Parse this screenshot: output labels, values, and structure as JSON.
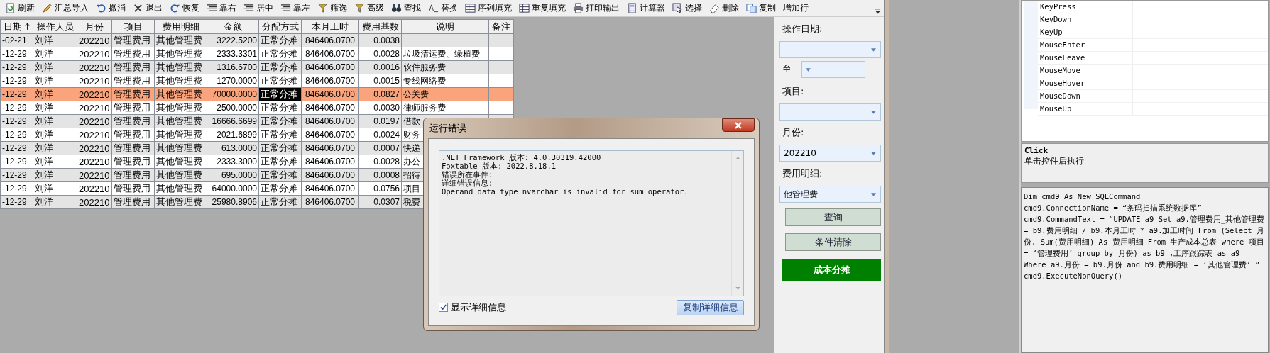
{
  "toolbar": {
    "items": [
      {
        "label": "刷新"
      },
      {
        "label": "汇总导入"
      },
      {
        "label": "撤消"
      },
      {
        "label": "退出"
      },
      {
        "label": "恢复"
      },
      {
        "label": "靠右"
      },
      {
        "label": "居中"
      },
      {
        "label": "靠左"
      },
      {
        "label": "筛选"
      },
      {
        "label": "高级"
      },
      {
        "label": "查找"
      },
      {
        "label": "替换"
      },
      {
        "label": "序列填充"
      },
      {
        "label": "重复填充"
      },
      {
        "label": "打印输出"
      },
      {
        "label": "计算器"
      },
      {
        "label": "选择"
      },
      {
        "label": "删除"
      },
      {
        "label": "复制"
      },
      {
        "label": "增加行"
      }
    ]
  },
  "table": {
    "columns": [
      {
        "label": "日期",
        "sorted_ascending": true,
        "current": false
      },
      {
        "label": "操作人员",
        "current": false
      },
      {
        "label": "月份",
        "current": false
      },
      {
        "label": "项目",
        "current": false
      },
      {
        "label": "费用明细",
        "current": false
      },
      {
        "label": "金额",
        "current": false
      },
      {
        "label": "分配方式",
        "current": true
      },
      {
        "label": "本月工时",
        "current": false
      },
      {
        "label": "费用基数",
        "current": false
      },
      {
        "label": "说明",
        "current": false
      },
      {
        "label": "备注",
        "current": false
      }
    ],
    "rows": [
      {
        "selected": false,
        "cells": [
          "-02-21",
          "刘洋",
          "202210",
          "管理费用",
          "其他管理费",
          "3222.5200",
          "正常分摊",
          "846406.0700",
          "0.0038"
        ]
      },
      {
        "selected": false,
        "cells": [
          "-12-29",
          "刘洋",
          "202210",
          "管理费用",
          "其他管理费",
          "2333.3301",
          "正常分摊",
          "846406.0700",
          "0.0028",
          "垃圾清运费、绿植费"
        ]
      },
      {
        "selected": false,
        "cells": [
          "-12-29",
          "刘洋",
          "202210",
          "管理费用",
          "其他管理费",
          "1316.6700",
          "正常分摊",
          "846406.0700",
          "0.0016",
          "软件服务费"
        ]
      },
      {
        "selected": false,
        "cells": [
          "-12-29",
          "刘洋",
          "202210",
          "管理费用",
          "其他管理费",
          "1270.0000",
          "正常分摊",
          "846406.0700",
          "0.0015",
          "专线网络费"
        ]
      },
      {
        "selected": true,
        "cells": [
          "-12-29",
          "刘洋",
          "202210",
          "管理费用",
          "其他管理费",
          "70000.0000",
          "正常分摊",
          "846406.0700",
          "0.0827",
          "公关费"
        ]
      },
      {
        "selected": false,
        "cells": [
          "-12-29",
          "刘洋",
          "202210",
          "管理费用",
          "其他管理费",
          "2500.0000",
          "正常分摊",
          "846406.0700",
          "0.0030",
          "律师服务费"
        ]
      },
      {
        "selected": false,
        "cells": [
          "-12-29",
          "刘洋",
          "202210",
          "管理费用",
          "其他管理费",
          "16666.6699",
          "正常分摊",
          "846406.0700",
          "0.0197",
          "借款"
        ]
      },
      {
        "selected": false,
        "cells": [
          "-12-29",
          "刘洋",
          "202210",
          "管理费用",
          "其他管理费",
          "2021.6899",
          "正常分摊",
          "846406.0700",
          "0.0024",
          "财务"
        ]
      },
      {
        "selected": false,
        "cells": [
          "-12-29",
          "刘洋",
          "202210",
          "管理费用",
          "其他管理费",
          "613.0000",
          "正常分摊",
          "846406.0700",
          "0.0007",
          "快递"
        ]
      },
      {
        "selected": false,
        "cells": [
          "-12-29",
          "刘洋",
          "202210",
          "管理费用",
          "其他管理费",
          "2333.3000",
          "正常分摊",
          "846406.0700",
          "0.0028",
          "办公"
        ]
      },
      {
        "selected": false,
        "cells": [
          "-12-29",
          "刘洋",
          "202210",
          "管理费用",
          "其他管理费",
          "695.0000",
          "正常分摊",
          "846406.0700",
          "0.0008",
          "招待"
        ]
      },
      {
        "selected": false,
        "cells": [
          "-12-29",
          "刘洋",
          "202210",
          "管理费用",
          "其他管理费",
          "64000.0000",
          "正常分摊",
          "846406.0700",
          "0.0756",
          "项目"
        ]
      },
      {
        "selected": false,
        "cells": [
          "-12-29",
          "刘洋",
          "202210",
          "管理费用",
          "其他管理费",
          "25980.8906",
          "正常分摊",
          "846406.0700",
          "0.0307",
          "税费"
        ]
      }
    ]
  },
  "filter_panel": {
    "items": [
      {
        "kind": "label",
        "text": "操作日期:"
      },
      {
        "kind": "combo"
      },
      {
        "kind": "range",
        "text": "至"
      },
      {
        "kind": "label",
        "text": "项目:"
      },
      {
        "kind": "combo"
      },
      {
        "kind": "label",
        "text": "月份:"
      },
      {
        "kind": "combo",
        "value": "202210"
      },
      {
        "kind": "label",
        "text": "费用明细:"
      },
      {
        "kind": "combo",
        "value": "他管理费"
      },
      {
        "kind": "button",
        "text": "查询"
      },
      {
        "kind": "button",
        "text": "条件清除"
      },
      {
        "kind": "primary",
        "text": "成本分摊"
      }
    ]
  },
  "dialog": {
    "title": "运行错误",
    "details": [
      ".NET Framework 版本: 4.0.30319.42000",
      "Foxtable 版本: 2022.8.18.1",
      "错误所在事件:",
      "详细错误信息:",
      "Operand data type nvarchar is invalid for sum operator."
    ],
    "show_details": {
      "label": "显示详细信息",
      "checked": true
    },
    "copy_button": "复制详细信息"
  },
  "event_list": {
    "items": [
      {
        "name": "KeyPress"
      },
      {
        "name": "KeyDown"
      },
      {
        "name": "KeyUp"
      },
      {
        "name": "MouseEnter"
      },
      {
        "name": "MouseLeave"
      },
      {
        "name": "MouseMove"
      },
      {
        "name": "MouseHover"
      },
      {
        "name": "MouseDown"
      },
      {
        "name": "MouseUp"
      }
    ]
  },
  "event_help": {
    "title": "Click",
    "text": "单击控件后执行"
  },
  "code": {
    "lines": [
      "Dim cmd9 As New SQLCommand",
      "cmd9.ConnectionName = “条码扫描系统数据库”",
      "cmd9.CommandText = “UPDATE  a9 Set a9.管理费用_其他管理费 = b9.费用明细 / b9.本月工时 * a9.加工时间   From (Select 月份, Sum(费用明细) As 费用明细  From 生产成本总表 where 项目 = ‘管理费用’ group by 月份) as b9 ,工序跟踪表 as a9 Where a9.月份 = b9.月份   and  b9.费用明细 = ‘其他管理费’ ”",
      "cmd9.ExecuteNonQuery()"
    ]
  }
}
